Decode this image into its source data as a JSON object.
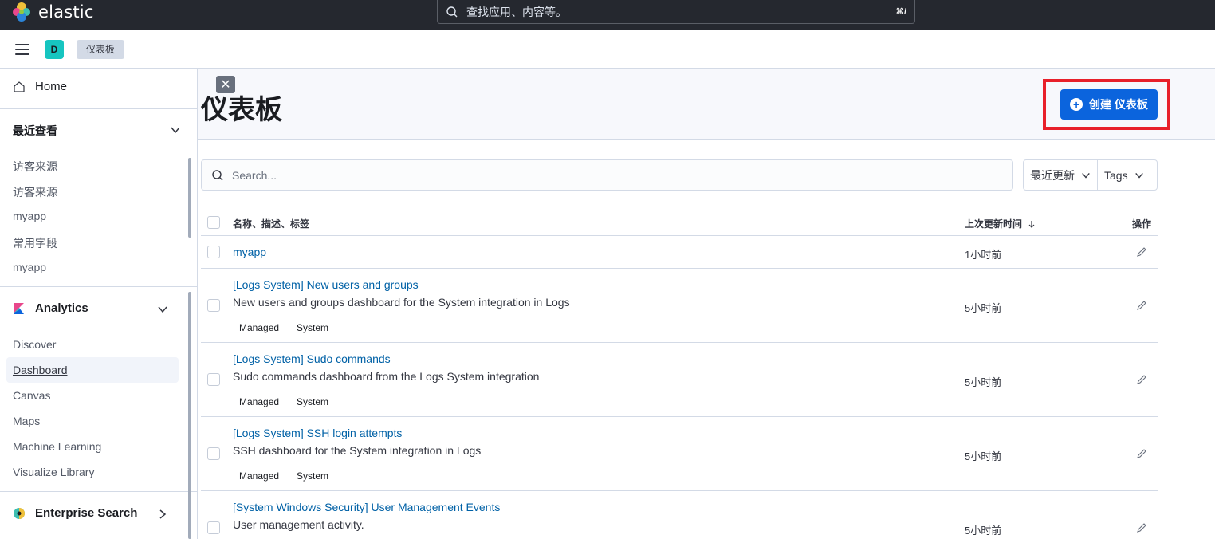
{
  "topbar": {
    "logo_text": "elastic",
    "search_placeholder": "查找应用、内容等。",
    "search_shortcut": "⌘/"
  },
  "subheader": {
    "space_initial": "D",
    "breadcrumb": "仪表板"
  },
  "sidebar": {
    "home": "Home",
    "recent_title": "最近查看",
    "recent_items": [
      "访客来源",
      "访客来源",
      "myapp",
      "常用字段",
      "myapp"
    ],
    "analytics_title": "Analytics",
    "analytics_items": [
      "Discover",
      "Dashboard",
      "Canvas",
      "Maps",
      "Machine Learning",
      "Visualize Library"
    ],
    "active_item": "Dashboard",
    "enterprise_title": "Enterprise Search"
  },
  "page": {
    "title": "仪表板",
    "create_button": "创建 仪表板",
    "search_placeholder": "Search...",
    "sort_label": "最近更新",
    "tags_label": "Tags"
  },
  "table": {
    "col_name": "名称、描述、标签",
    "col_updated": "上次更新时间",
    "col_actions": "操作",
    "rows": [
      {
        "title": "myapp",
        "desc": "",
        "tags": [],
        "time": "1小时前"
      },
      {
        "title": "[Logs System] New users and groups",
        "desc": "New users and groups dashboard for the System integration in Logs",
        "tags": [
          "Managed",
          "System"
        ],
        "time": "5小时前"
      },
      {
        "title": "[Logs System] Sudo commands",
        "desc": "Sudo commands dashboard from the Logs System integration",
        "tags": [
          "Managed",
          "System"
        ],
        "time": "5小时前"
      },
      {
        "title": "[Logs System] SSH login attempts",
        "desc": "SSH dashboard for the System integration in Logs",
        "tags": [
          "Managed",
          "System"
        ],
        "time": "5小时前"
      },
      {
        "title": "[System Windows Security] User Management Events",
        "desc": "User management activity.",
        "tags": [],
        "time": "5小时前"
      }
    ]
  },
  "colors": {
    "topbar_bg": "#25282f",
    "primary": "#0b64dd",
    "link": "#0061a6",
    "highlight": "#e8202a"
  }
}
